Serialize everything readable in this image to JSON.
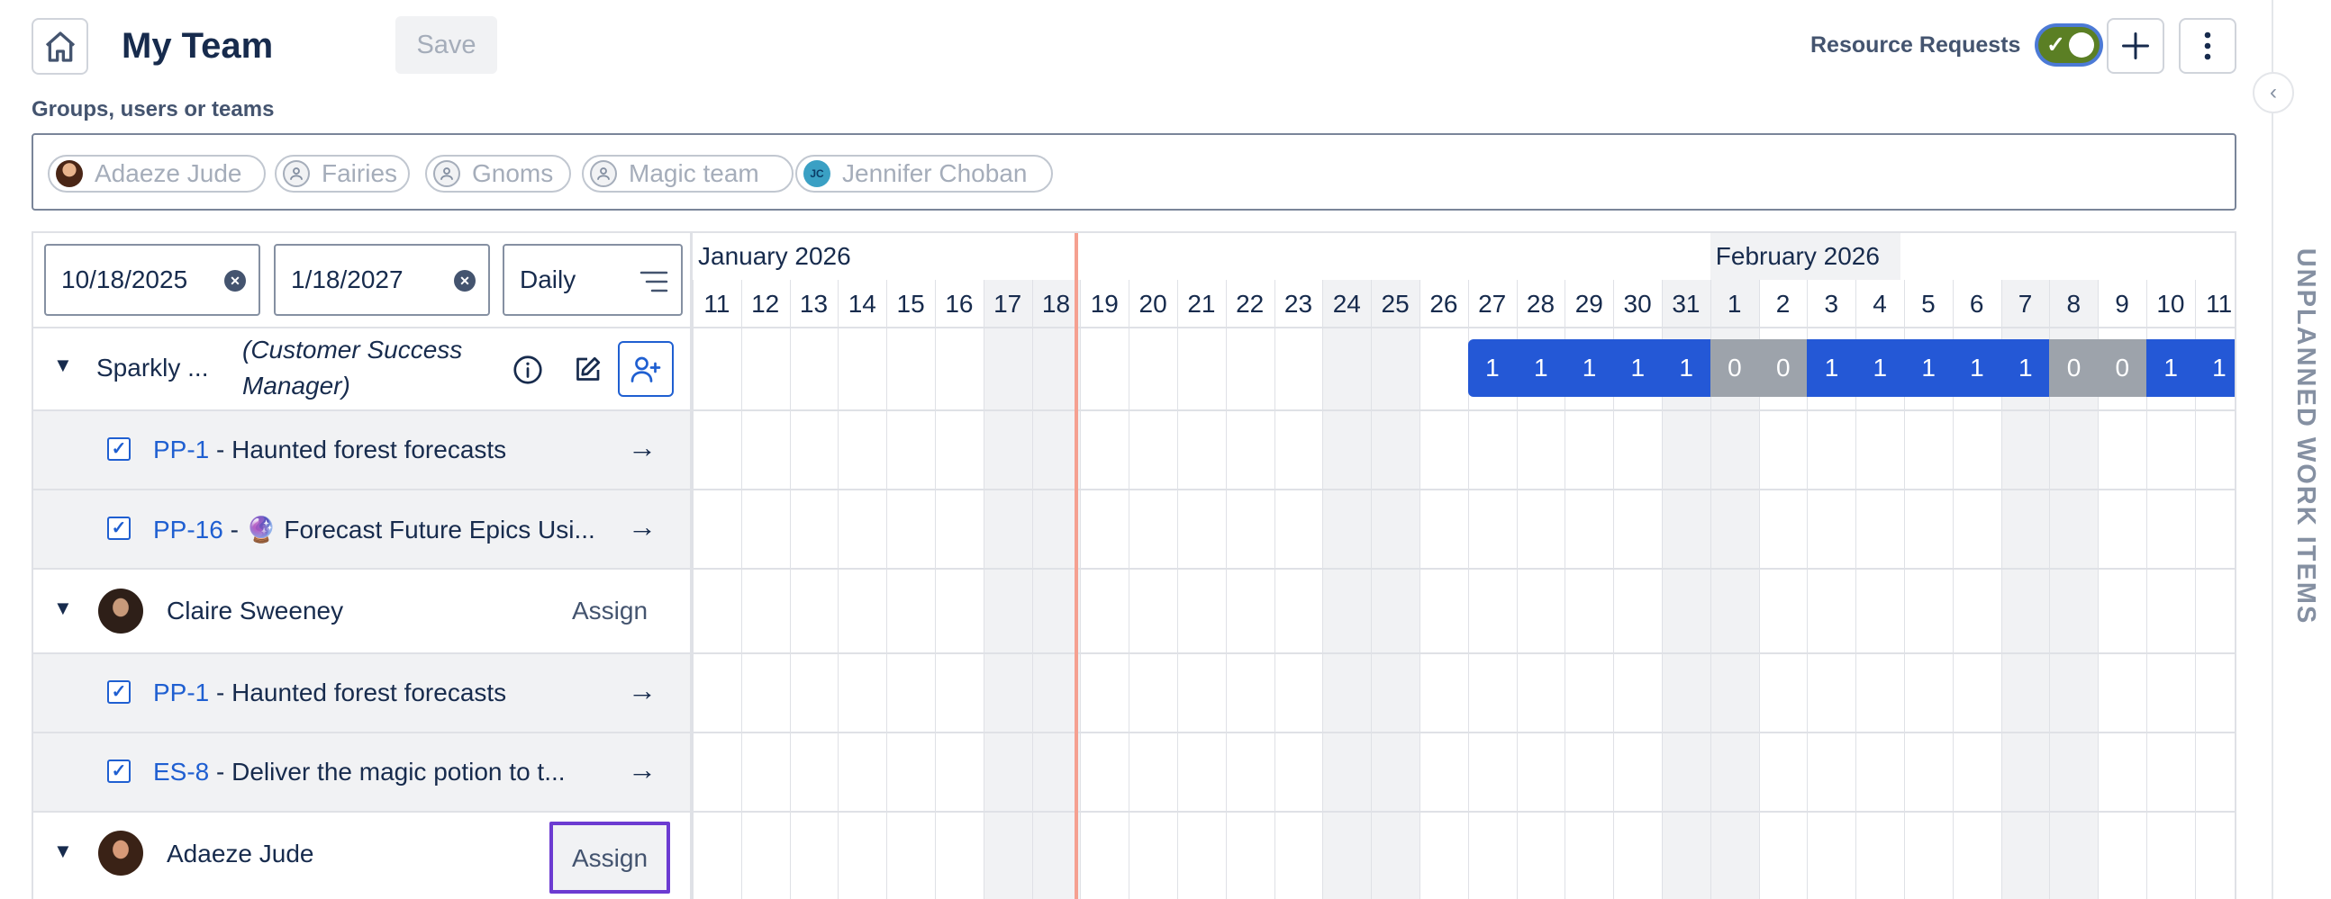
{
  "header": {
    "title": "My Team",
    "save_label": "Save",
    "resource_requests_label": "Resource Requests",
    "resource_requests_on": true,
    "toggle_check": "✓",
    "add_icon": "plus-icon",
    "more_icon": "more-vertical-icon",
    "home_icon": "home-icon"
  },
  "side_panel": {
    "label": "UNPLANNED WORK ITEMS",
    "collapse_glyph": "‹"
  },
  "groups": {
    "label": "Groups, users or teams",
    "chips": [
      {
        "label": "Adaeze Jude",
        "kind": "person"
      },
      {
        "label": "Fairies",
        "kind": "group"
      },
      {
        "label": "Gnoms",
        "kind": "group"
      },
      {
        "label": "Magic team",
        "kind": "group"
      },
      {
        "label": "Jennifer Choban",
        "kind": "initials",
        "initials": "JC"
      }
    ]
  },
  "controls": {
    "start_date": "10/18/2025",
    "end_date": "1/18/2027",
    "granularity": "Daily",
    "clear_glyph": "✕"
  },
  "rows": [
    {
      "type": "role",
      "name": "Sparkly ...",
      "role_line1": "(Customer Success",
      "role_line2": "Manager)"
    },
    {
      "type": "task",
      "key": "PP-1",
      "title": " - Haunted forest forecasts"
    },
    {
      "type": "task",
      "key": "PP-16",
      "title": " - 🔮 Forecast Future Epics Usi..."
    },
    {
      "type": "user",
      "name": "Claire Sweeney",
      "action": "Assign"
    },
    {
      "type": "task",
      "key": "PP-1",
      "title": " - Haunted forest forecasts"
    },
    {
      "type": "task",
      "key": "ES-8",
      "title": " - Deliver the magic potion to t..."
    },
    {
      "type": "user",
      "name": "Adaeze Jude",
      "action": "Assign"
    }
  ],
  "timeline": {
    "months": [
      {
        "label": "January 2026",
        "start_index": 0
      },
      {
        "label": "February 2026",
        "start_index": 21
      }
    ],
    "days": [
      "11",
      "12",
      "13",
      "14",
      "15",
      "16",
      "17",
      "18",
      "19",
      "20",
      "21",
      "22",
      "23",
      "24",
      "25",
      "26",
      "27",
      "28",
      "29",
      "30",
      "31",
      "1",
      "2",
      "3",
      "4",
      "5",
      "6",
      "7",
      "8",
      "9",
      "10",
      "11"
    ],
    "weekend_days": [
      6,
      7,
      13,
      14,
      20,
      21,
      27,
      28
    ],
    "today_index": 7,
    "allocation_start_index": 16,
    "allocations": [
      1,
      1,
      1,
      1,
      1,
      0,
      0,
      1,
      1,
      1,
      1,
      1,
      0,
      0,
      1,
      1
    ]
  },
  "colors": {
    "allocation_on": "#2458d6",
    "allocation_off": "#9da3ab",
    "toggle_on": "#5b7f24",
    "link": "#1f5fd1",
    "today_line": "#f5a090",
    "assign_focus": "#6c3bd1"
  }
}
